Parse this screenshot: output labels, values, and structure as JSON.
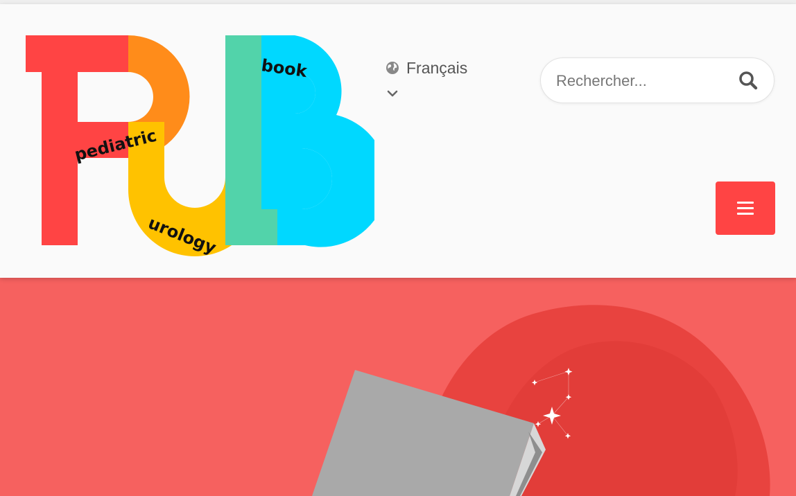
{
  "logo": {
    "letters": [
      "P",
      "U",
      "B"
    ],
    "words": {
      "pediatric": "pediatric",
      "urology": "urology",
      "book": "book"
    },
    "colors": {
      "red": "#ff4444",
      "orange": "#ff8c1a",
      "yellow": "#ffc200",
      "teal": "#52d3aa",
      "cyan": "#00d8ff"
    }
  },
  "language": {
    "label": "Français",
    "icon": "globe-icon",
    "toggle_icon": "chevron-down-icon"
  },
  "search": {
    "placeholder": "Rechercher...",
    "icon": "search-icon"
  },
  "menu": {
    "icon": "hamburger-icon",
    "color": "#ff4444"
  },
  "hero": {
    "background": "#f6615f",
    "book_color": "#a9a9a9",
    "icon": "sparkle-icon"
  }
}
